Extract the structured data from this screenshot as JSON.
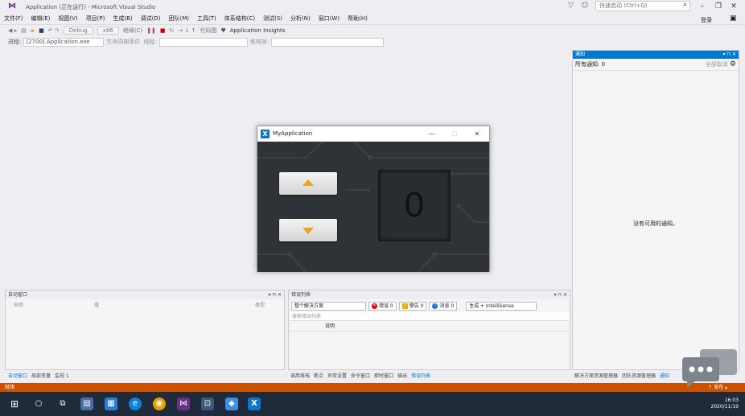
{
  "window": {
    "title": "Application (正在运行) - Microsoft Visual Studio",
    "quick_launch": "快速启动 (Ctrl+Q)",
    "login": "登录"
  },
  "menu": [
    "文件(F)",
    "编辑(E)",
    "视图(V)",
    "项目(P)",
    "生成(B)",
    "调试(D)",
    "团队(M)",
    "工具(T)",
    "体系结构(C)",
    "测试(S)",
    "分析(N)",
    "窗口(W)",
    "帮助(H)"
  ],
  "toolbar": {
    "config": "Debug",
    "platform": "x86",
    "continue": "继续(C)",
    "codemap": "代码图",
    "insights": "Application Insights"
  },
  "process": {
    "label": "进程:",
    "value": "[2700] Application.exe",
    "lifecycle": "生命周期事件",
    "thread": "线程:",
    "stackframe": "堆栈帧:"
  },
  "notifications": {
    "title": "通知",
    "count": "所有通知: 0",
    "dismiss_all": "全部取消",
    "empty": "没有可用的通知。"
  },
  "myapp": {
    "title": "MyApplication",
    "counter": "0"
  },
  "autos": {
    "title": "自动窗口",
    "cols": [
      "名称",
      "值",
      "类型"
    ],
    "tabs": [
      "自动窗口",
      "局部变量",
      "监视 1"
    ]
  },
  "errors": {
    "title": "错误列表",
    "scope": "整个解决方案",
    "errors": "错误 0",
    "warnings": "警告 0",
    "messages": "消息 0",
    "build": "生成 + IntelliSense",
    "search": "搜索错误列表",
    "col_desc": "说明",
    "tabs": [
      "调用堆栈",
      "断点",
      "异常设置",
      "命令窗口",
      "即时窗口",
      "输出",
      "错误列表"
    ]
  },
  "right_tabs": [
    "解决方案资源管理器",
    "团队资源管理器",
    "通知"
  ],
  "status": {
    "left": "就绪",
    "publish": "↑ 发布 ▴"
  },
  "taskbar": {
    "time": "16:03",
    "date": "2020/11/19"
  },
  "colors": {
    "accent": "#007acc",
    "status": "#ca5100",
    "taskbar": "#1f2b3b",
    "arrow": "#f0a020"
  }
}
